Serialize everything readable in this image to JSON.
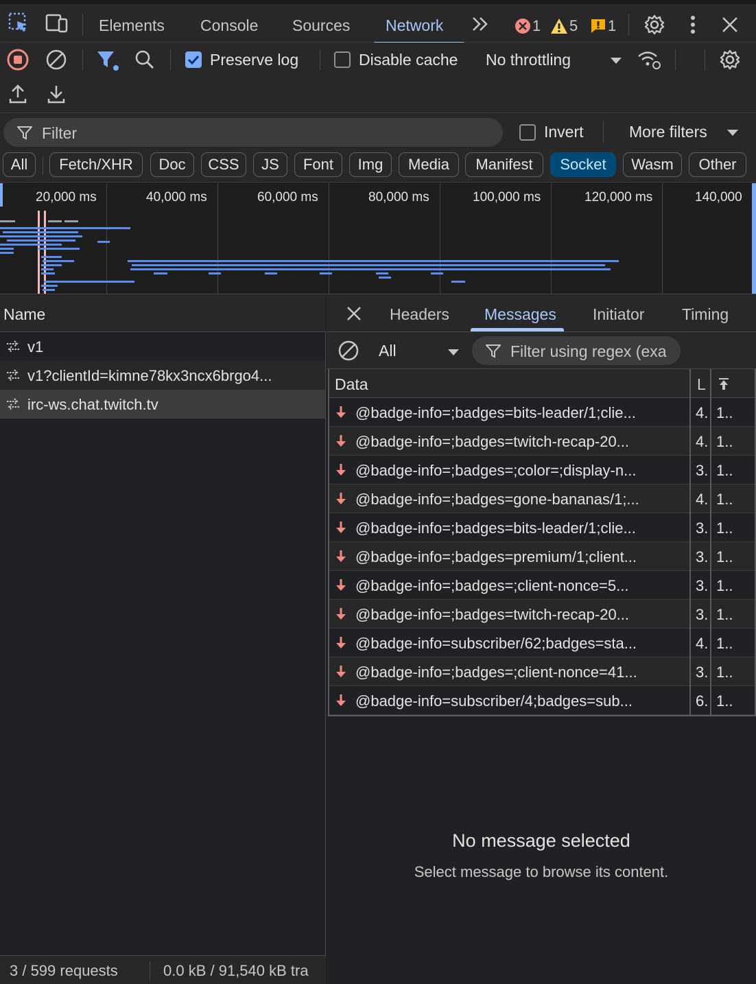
{
  "panel_tabs": [
    "Elements",
    "Console",
    "Sources",
    "Network"
  ],
  "active_panel": "Network",
  "counters": {
    "errors": "1",
    "warnings": "5",
    "issues": "1"
  },
  "toolbar": {
    "preserve_log_label": "Preserve log",
    "preserve_log_checked": true,
    "disable_cache_label": "Disable cache",
    "disable_cache_checked": false,
    "throttling": "No throttling"
  },
  "filter": {
    "placeholder": "Filter",
    "invert_label": "Invert",
    "more_filters_label": "More filters"
  },
  "type_chips": [
    "All",
    "Fetch/XHR",
    "Doc",
    "CSS",
    "JS",
    "Font",
    "Img",
    "Media",
    "Manifest",
    "Socket",
    "Wasm",
    "Other"
  ],
  "active_chip": "Socket",
  "timeline": {
    "labels": [
      "20,000 ms",
      "40,000 ms",
      "60,000 ms",
      "80,000 ms",
      "100,000 ms",
      "120,000 ms",
      "140,000"
    ]
  },
  "requests": {
    "column_header": "Name",
    "items": [
      "v1",
      "v1?clientId=kimne78kx3ncx6brgo4...",
      "irc-ws.chat.twitch.tv"
    ],
    "selected_index": 2
  },
  "status": {
    "requests": "3 / 599 requests",
    "transferred": "0.0 kB / 91,540 kB tra"
  },
  "detail": {
    "tabs": [
      "Headers",
      "Messages",
      "Initiator",
      "Timing"
    ],
    "active_tab": "Messages",
    "message_filter": "All",
    "regex_placeholder": "Filter using regex (exa",
    "columns": {
      "data": "Data",
      "length": "L",
      "time": ""
    },
    "messages": [
      {
        "data": "@badge-info=;badges=bits-leader/1;clie...",
        "length": "4.",
        "time": "1.."
      },
      {
        "data": "@badge-info=;badges=twitch-recap-20...",
        "length": "4.",
        "time": "1.."
      },
      {
        "data": "@badge-info=;badges=;color=;display-n...",
        "length": "3.",
        "time": "1.."
      },
      {
        "data": "@badge-info=;badges=gone-bananas/1;...",
        "length": "4.",
        "time": "1.."
      },
      {
        "data": "@badge-info=;badges=bits-leader/1;clie...",
        "length": "3.",
        "time": "1.."
      },
      {
        "data": "@badge-info=;badges=premium/1;client...",
        "length": "3.",
        "time": "1.."
      },
      {
        "data": "@badge-info=;badges=;client-nonce=5...",
        "length": "3.",
        "time": "1.."
      },
      {
        "data": "@badge-info=;badges=twitch-recap-20...",
        "length": "3.",
        "time": "1.."
      },
      {
        "data": "@badge-info=subscriber/62;badges=sta...",
        "length": "4.",
        "time": "1.."
      },
      {
        "data": "@badge-info=;badges=;client-nonce=41...",
        "length": "3.",
        "time": "1.."
      },
      {
        "data": "@badge-info=subscriber/4;badges=sub...",
        "length": "6.",
        "time": "1.."
      }
    ],
    "empty_title": "No message selected",
    "empty_subtitle": "Select message to browse its content."
  },
  "colors": {
    "accent": "#a8c7fa",
    "socket_chip": "#004a77",
    "recording": "#f28b82",
    "error": "#f28b82",
    "warning": "#fdd663",
    "issue": "#f9ab00",
    "bar": "#5b8def"
  }
}
